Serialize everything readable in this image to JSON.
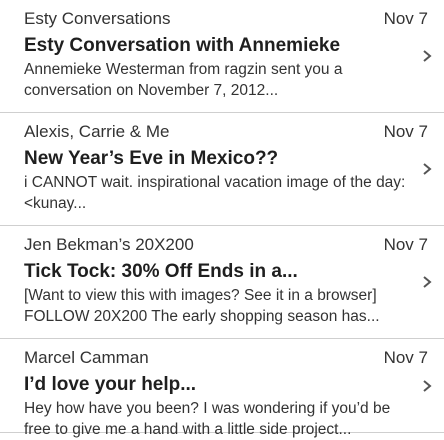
{
  "messages": [
    {
      "sender": "Esty Conversations",
      "date": "Nov 7",
      "subject": "Esty Conversation with Annemieke",
      "preview": "Annemieke Westerman from ragzin sent you a conversation on November 7, 2012..."
    },
    {
      "sender": "Alexis, Carrie & Me",
      "date": "Nov 7",
      "subject": "New Year’s Eve in Mexico??",
      "preview": "i CANNOT wait. inspirational vacation image of the day: <kunay..."
    },
    {
      "sender": "Jen Bekman’s 20X200",
      "date": "Nov 7",
      "subject": "Tick Tock: 30% Off Ends in a...",
      "preview": "[Want to view this with images? See it in a browser] FOLLOW 20X200 The early shopping season has..."
    },
    {
      "sender": "Marcel Camman",
      "date": "Nov 7",
      "subject": "I’d love your help...",
      "preview": "Hey how have you been? I was wondering if you’d be free to give me a hand with a little side project..."
    }
  ],
  "icons": {
    "row_chevron": "chevron-right-icon"
  },
  "colors": {
    "divider": "#cfcfcf",
    "chevron": "#555555",
    "text": "#333333"
  }
}
